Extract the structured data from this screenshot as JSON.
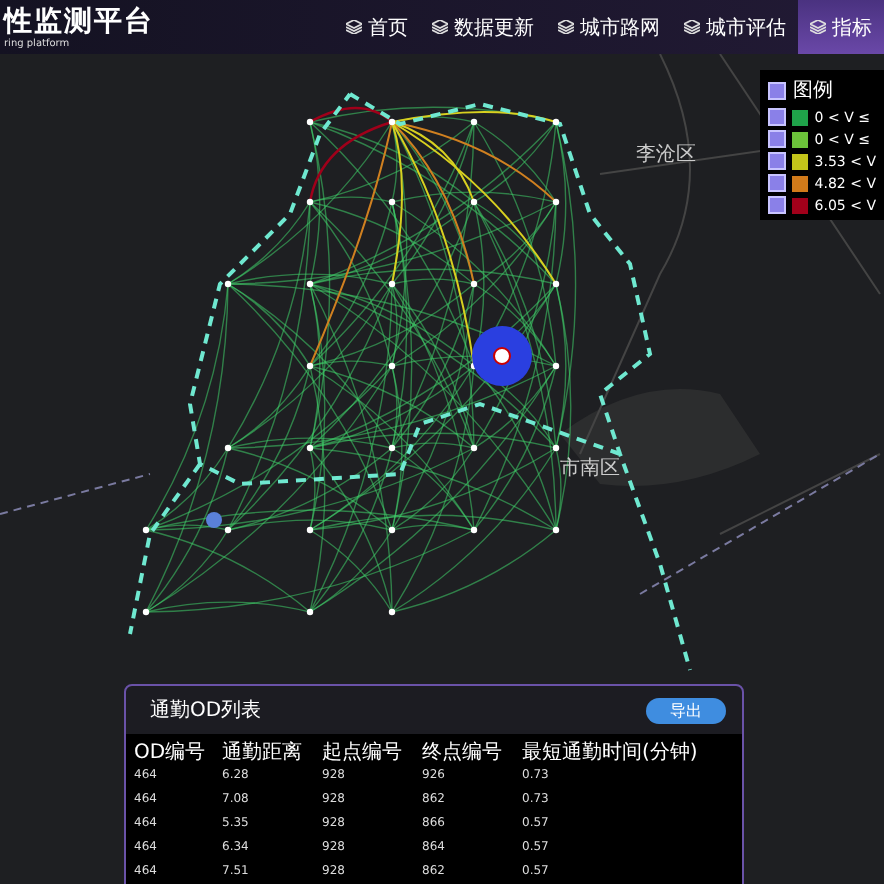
{
  "header": {
    "title": "性监测平台",
    "subtitle": "ring platform"
  },
  "nav": [
    {
      "label": "首页",
      "selected": false
    },
    {
      "label": "数据更新",
      "selected": false
    },
    {
      "label": "城市路网",
      "selected": false
    },
    {
      "label": "城市评估",
      "selected": false
    },
    {
      "label": "指标",
      "selected": true
    }
  ],
  "map": {
    "labels": [
      "李沧区",
      "市南区"
    ]
  },
  "legend": {
    "title": "图例",
    "checked": true,
    "items": [
      {
        "label": "0 < V ≤",
        "color": "#1fa34a",
        "checked": true
      },
      {
        "label": "0 < V ≤",
        "color": "#6cc23a",
        "checked": true
      },
      {
        "label": "3.53 < V",
        "color": "#c3c41a",
        "checked": true
      },
      {
        "label": "4.82 < V",
        "color": "#d07a1a",
        "checked": true
      },
      {
        "label": "6.05 < V",
        "color": "#a0001a",
        "checked": true
      }
    ]
  },
  "od_panel": {
    "title": "通勤OD列表",
    "export_button": "导出",
    "columns": [
      "OD编号",
      "通勤距离",
      "起点编号",
      "终点编号",
      "最短通勤时间(分钟)"
    ],
    "rows": [
      [
        "464",
        "6.28",
        "928",
        "926",
        "0.73"
      ],
      [
        "464",
        "7.08",
        "928",
        "862",
        "0.73"
      ],
      [
        "464",
        "5.35",
        "928",
        "866",
        "0.57"
      ],
      [
        "464",
        "6.34",
        "928",
        "864",
        "0.57"
      ],
      [
        "464",
        "7.51",
        "928",
        "862",
        "0.57"
      ]
    ]
  }
}
